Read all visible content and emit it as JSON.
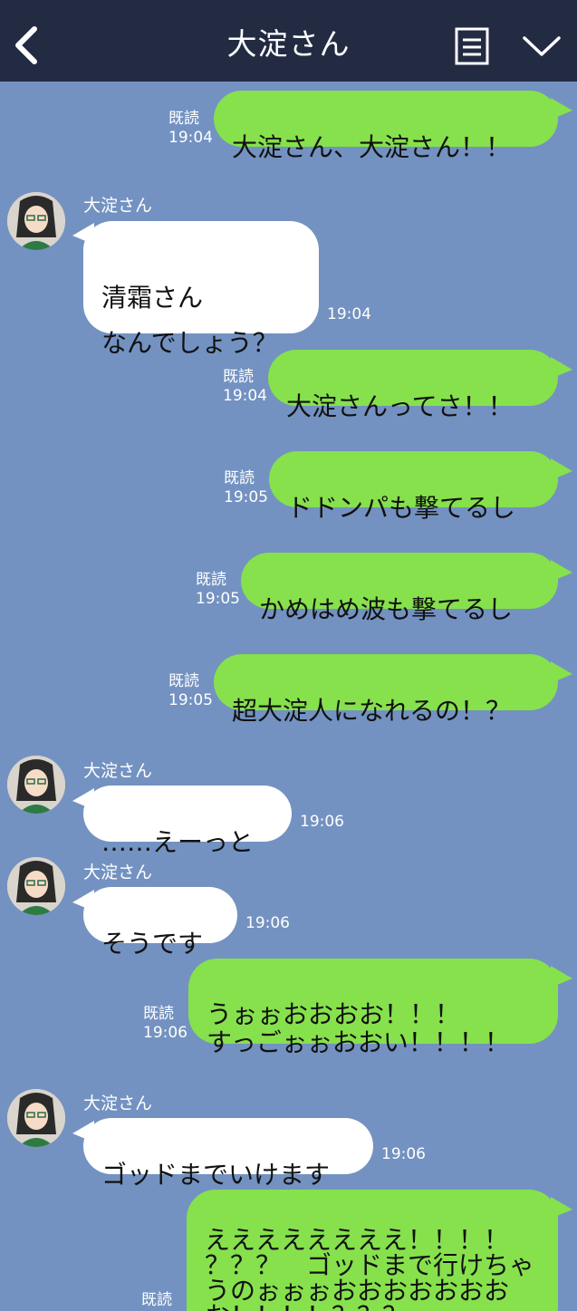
{
  "header": {
    "title": "大淀さん",
    "back_icon": "chevron-left-icon",
    "notes_icon": "notes-icon",
    "menu_icon": "chevron-down-icon"
  },
  "colors": {
    "header_bg": "#232b43",
    "chat_bg": "#7392c1",
    "sent_bubble": "#86e14c",
    "received_bubble": "#ffffff"
  },
  "messages": [
    {
      "direction": "sent",
      "text": "大淀さん、大淀さん！！",
      "read": "既読",
      "time": "19:04"
    },
    {
      "direction": "received",
      "sender": "大淀さん",
      "text": "清霜さん\nなんでしょう？",
      "time": "19:04"
    },
    {
      "direction": "sent",
      "text": "大淀さんってさ！！",
      "read": "既読",
      "time": "19:04"
    },
    {
      "direction": "sent",
      "text": "ドドンパも撃てるし",
      "read": "既読",
      "time": "19:05"
    },
    {
      "direction": "sent",
      "text": "かめはめ波も撃てるし",
      "read": "既読",
      "time": "19:05"
    },
    {
      "direction": "sent",
      "text": "超大淀人になれるの！？",
      "read": "既読",
      "time": "19:05"
    },
    {
      "direction": "received",
      "sender": "大淀さん",
      "text": "……えーっと",
      "time": "19:06"
    },
    {
      "direction": "received",
      "sender": "大淀さん",
      "text": "そうです",
      "time": "19:06"
    },
    {
      "direction": "sent",
      "text": "うぉぉおおおお！！！\nすっごぉぉおおい！！！！",
      "read": "既読",
      "time": "19:06"
    },
    {
      "direction": "received",
      "sender": "大淀さん",
      "text": "ゴッドまでいけます",
      "time": "19:06"
    },
    {
      "direction": "sent",
      "text": "ええええええええ！！！！\n？？？　ゴッドまで行けちゃうのぉぉぉおおおおおおおお！！！！？？？",
      "read": "既読",
      "time": ""
    }
  ]
}
